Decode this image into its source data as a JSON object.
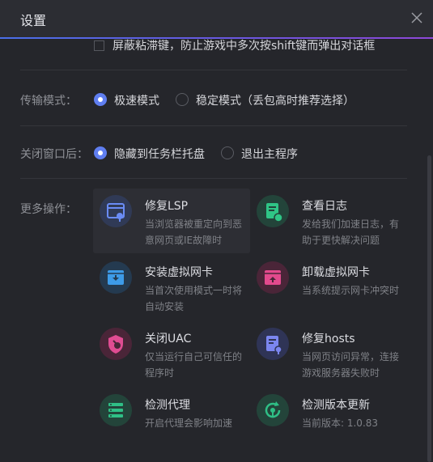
{
  "window": {
    "title": "设置"
  },
  "checkbox": {
    "label": "屏蔽粘滞键，防止游戏中多次按shift键而弹出对话框",
    "checked": false
  },
  "transfer": {
    "label": "传输模式：",
    "options": [
      {
        "label": "极速模式",
        "selected": true
      },
      {
        "label": "稳定模式（丢包高时推荐选择）",
        "selected": false
      }
    ]
  },
  "close_behavior": {
    "label": "关闭窗口后：",
    "options": [
      {
        "label": "隐藏到任务栏托盘",
        "selected": true
      },
      {
        "label": "退出主程序",
        "selected": false
      }
    ]
  },
  "more": {
    "label": "更多操作：",
    "items": [
      {
        "title": "修复LSP",
        "desc1": "当浏览器被重定向到恶",
        "desc2": "意网页或IE故障时",
        "icon": "browser-repair-icon",
        "color": "#6a8cf5",
        "bg": "#303a56"
      },
      {
        "title": "查看日志",
        "desc1": "发给我们加速日志，有",
        "desc2": "助于更快解决问题",
        "icon": "log-file-icon",
        "color": "#2fc586",
        "bg": "#23443a"
      },
      {
        "title": "安装虚拟网卡",
        "desc1": "当首次使用模式一时将",
        "desc2": "自动安装",
        "icon": "install-adapter-icon",
        "color": "#3d9be8",
        "bg": "#243a50"
      },
      {
        "title": "卸载虚拟网卡",
        "desc1": "当系统提示网卡冲突时",
        "desc2": "",
        "icon": "uninstall-adapter-icon",
        "color": "#e24a8d",
        "bg": "#4a2538"
      },
      {
        "title": "关闭UAC",
        "desc1": "仅当运行自己可信任的",
        "desc2": "程序时",
        "icon": "uac-shield-icon",
        "color": "#e04c92",
        "bg": "#4a2538"
      },
      {
        "title": "修复hosts",
        "desc1": "当网页访问异常，连接",
        "desc2": "游戏服务器失败时",
        "icon": "hosts-repair-icon",
        "color": "#7b86f0",
        "bg": "#2f3456"
      },
      {
        "title": "检测代理",
        "desc1": "开启代理会影响加速",
        "desc2": "",
        "icon": "proxy-check-icon",
        "color": "#2fbf86",
        "bg": "#23443a"
      },
      {
        "title": "检测版本更新",
        "desc1": "当前版本: 1.0.83",
        "desc2": "",
        "icon": "update-check-icon",
        "color": "#2fbf86",
        "bg": "#23443a"
      }
    ]
  }
}
